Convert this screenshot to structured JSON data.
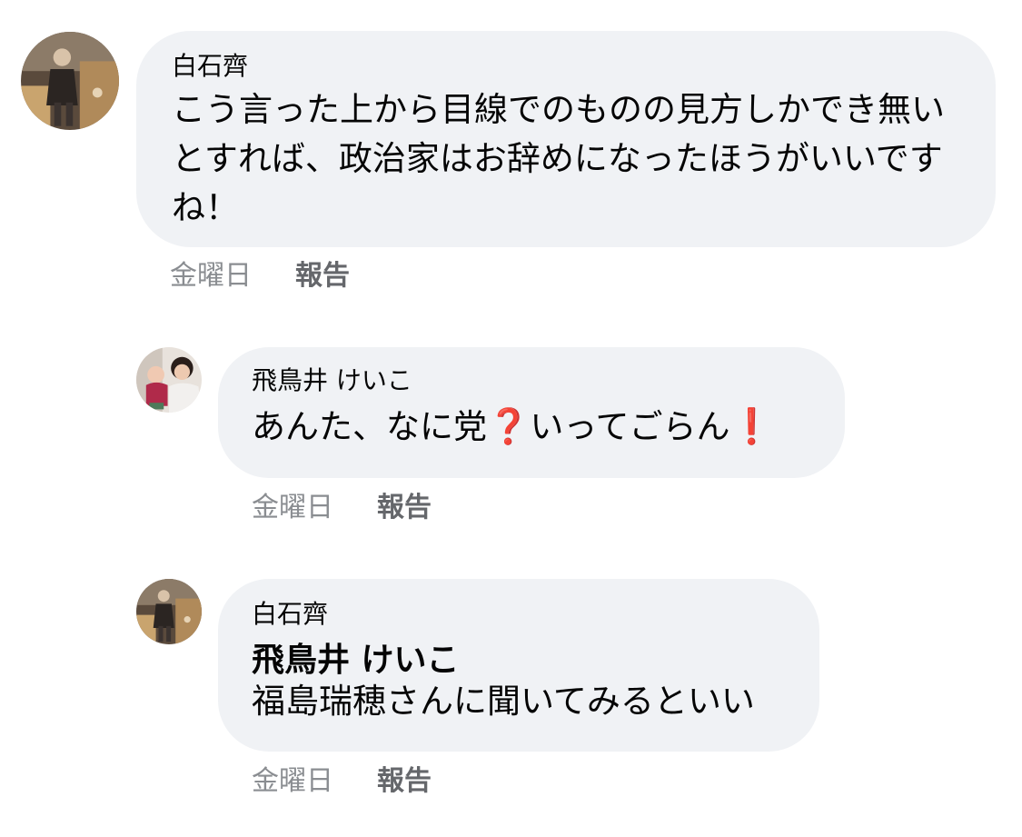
{
  "comments": [
    {
      "author": "白石齊",
      "text": "こう言った上から目線でのものの見方しかでき無いとすれば、政治家はお辞めになったほうがいいですね！",
      "time": "金曜日",
      "action": "報告",
      "avatar": "elderly-man-photo-icon"
    },
    {
      "author": "飛鳥井 けいこ",
      "text_part1": "あんた、なに党",
      "emoji1": "❓",
      "text_part2": "いってごらん",
      "emoji2": "❗",
      "time": "金曜日",
      "action": "報告",
      "avatar": "woman-with-child-photo-icon"
    },
    {
      "author": "白石齊",
      "mention": "飛鳥井 けいこ",
      "text": "福島瑞穂さんに聞いてみるといい",
      "time": "金曜日",
      "action": "報告",
      "avatar": "elderly-man-photo-icon"
    }
  ],
  "colors": {
    "bubble": "#f0f2f5",
    "meta_time": "#8a8d91",
    "meta_action": "#65676b",
    "emoji_red": "#e0292e"
  }
}
